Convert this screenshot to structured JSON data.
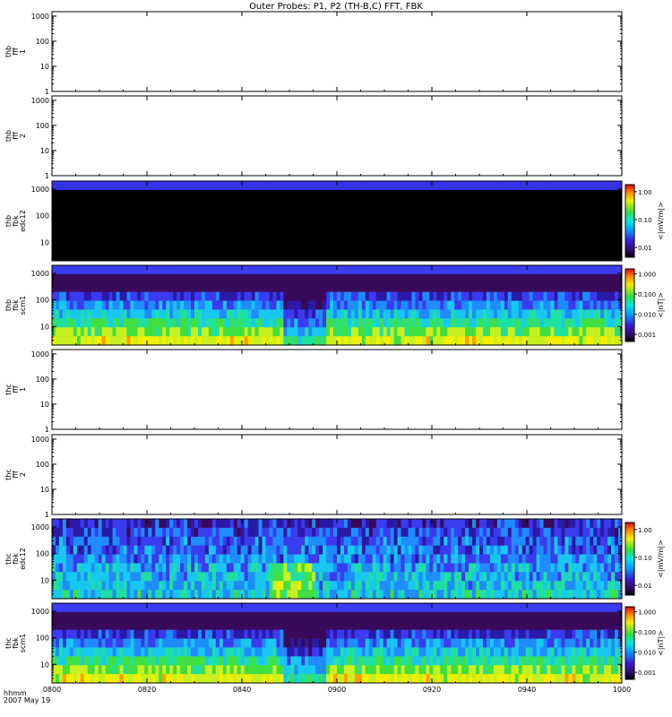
{
  "chart_data": {
    "type": "heatmap",
    "title": "Outer Probes: P1, P2 (TH-B,C) FFT, FBK",
    "x_axis": {
      "ticks": [
        "0800",
        "0820",
        "0840",
        "0900",
        "0920",
        "0940",
        "1000"
      ],
      "row_label": "hhmm",
      "date_label": "2007 May 19"
    },
    "y_ticks": [
      "1",
      "10",
      "100",
      "1000"
    ],
    "cbar_volt": [
      "0.01",
      "0.10",
      "1.00"
    ],
    "cbar_mag": [
      "0.001",
      "0.010",
      "0.100",
      "1.000"
    ],
    "panels": [
      {
        "id": "thb-fff1",
        "label": [
          "thb",
          "fff",
          "1"
        ],
        "ylim": [
          1,
          1500
        ],
        "filled": false
      },
      {
        "id": "thb-fff2",
        "label": [
          "thb",
          "fff",
          "2"
        ],
        "ylim": [
          1,
          1500
        ],
        "filled": false
      },
      {
        "id": "thb-fbk-edc12",
        "label": [
          "thb",
          "fbk",
          "edc12"
        ],
        "ylim": [
          2,
          2000
        ],
        "filled": true,
        "pattern": "dark",
        "cbar_unit": "<|mV/m|>"
      },
      {
        "id": "thb-fbk-scm1",
        "label": [
          "thb",
          "fbk",
          "scm1"
        ],
        "ylim": [
          2,
          2000
        ],
        "filled": true,
        "pattern": "scm",
        "cbar_unit": "<|nT|>"
      },
      {
        "id": "thc-fff1",
        "label": [
          "thc",
          "fff",
          "1"
        ],
        "ylim": [
          1,
          1500
        ],
        "filled": false
      },
      {
        "id": "thc-fff2",
        "label": [
          "thc",
          "fff",
          "2"
        ],
        "ylim": [
          1,
          1500
        ],
        "filled": false
      },
      {
        "id": "thc-fbk-edc12",
        "label": [
          "thc",
          "fbk",
          "edc12"
        ],
        "ylim": [
          2,
          2000
        ],
        "filled": true,
        "pattern": "edc",
        "cbar_unit": "<|mV/m|>"
      },
      {
        "id": "thc-fbk-scm1",
        "label": [
          "thc",
          "fbk",
          "scm1"
        ],
        "ylim": [
          2,
          2000
        ],
        "filled": true,
        "pattern": "scm",
        "cbar_unit": "<|nT|>"
      }
    ]
  }
}
